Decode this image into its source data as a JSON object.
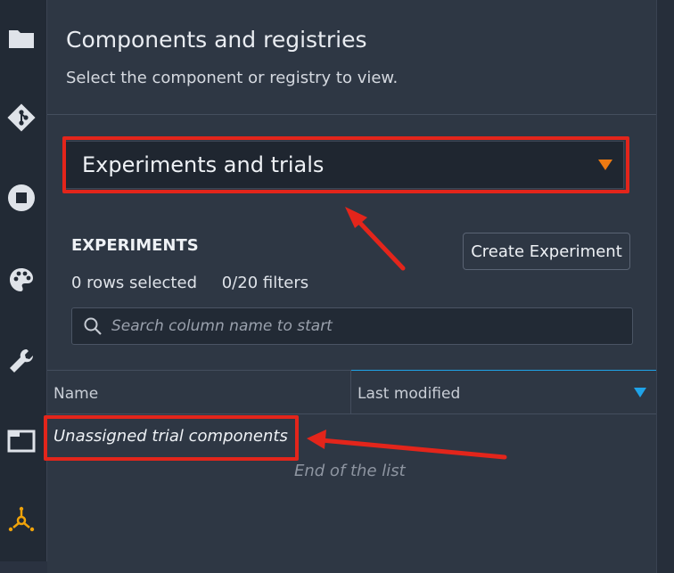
{
  "sidebar": {
    "items": [
      {
        "icon": "folder-icon"
      },
      {
        "icon": "git-icon"
      },
      {
        "icon": "stop-icon"
      },
      {
        "icon": "palette-icon"
      },
      {
        "icon": "wrench-icon"
      },
      {
        "icon": "window-icon"
      },
      {
        "icon": "experiments-icon",
        "active": true
      }
    ]
  },
  "panel": {
    "title": "Components and registries",
    "subtitle": "Select the component or registry to view."
  },
  "dropdown": {
    "selected": "Experiments and trials",
    "caret_color": "#ee7a12"
  },
  "experiments": {
    "heading": "EXPERIMENTS",
    "create_button": "Create Experiment",
    "rows_selected": "0 rows selected",
    "filters": "0/20 filters",
    "search_placeholder": "Search column name to start"
  },
  "table": {
    "columns": [
      "Name",
      "Last modified"
    ],
    "rows": [
      "Unassigned trial components"
    ],
    "footer": "End of the list",
    "sort_color": "#1fa3e8"
  },
  "colors": {
    "highlight": "#e3251b",
    "accent": "#ee7a12",
    "panel_bg": "#2e3744",
    "sidebar_bg": "#222a35"
  }
}
